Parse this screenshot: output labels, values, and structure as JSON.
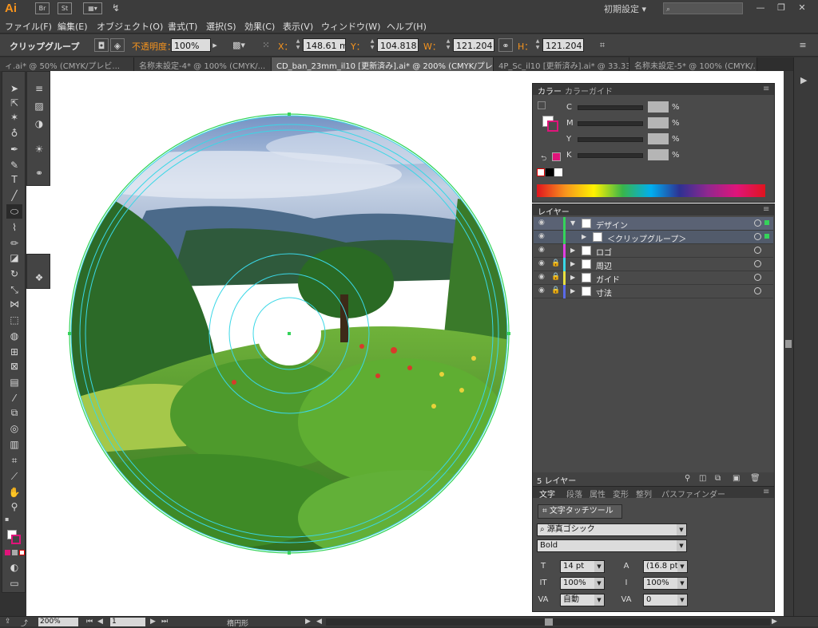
{
  "app": {
    "logo": "Ai",
    "icon_bridge": "Br",
    "icon_stock": "St",
    "workspace_preset": "初期設定",
    "window_minimize": "—",
    "window_restore": "❐",
    "window_close": "✕"
  },
  "menu": [
    "ファイル(F)",
    "編集(E)",
    "オブジェクト(O)",
    "書式(T)",
    "選択(S)",
    "効果(C)",
    "表示(V)",
    "ウィンドウ(W)",
    "ヘルプ(H)"
  ],
  "control": {
    "selection_type": "クリップグループ",
    "opacity_label": "不透明度：",
    "opacity_value": "100%",
    "x_label": "X：",
    "x_value": "148.61 mr",
    "y_label": "Y：",
    "y_value": "104.818 m",
    "w_label": "W：",
    "w_value": "121.204 m",
    "h_label": "H：",
    "h_value": "121.204 m"
  },
  "tabs": [
    {
      "label": "ィ.ai* @ 50% (CMYK/プレビ...",
      "active": false
    },
    {
      "label": "名称未設定-4* @ 100% (CMYK/...",
      "active": false
    },
    {
      "label": "CD_ban_23mm_il10 [更新済み].ai* @ 200% (CMYK/プレビュー)",
      "active": true
    },
    {
      "label": "4P_Sc_il10 [更新済み].ai* @ 33.33...",
      "active": false
    },
    {
      "label": "名称未設定-5* @ 100% (CMYK/...",
      "active": false
    }
  ],
  "color_panel": {
    "tab_color": "カラー",
    "tab_guide": "カラーガイド",
    "channels": [
      {
        "label": "C",
        "pct": "%"
      },
      {
        "label": "M",
        "pct": "%"
      },
      {
        "label": "Y",
        "pct": "%"
      },
      {
        "label": "K",
        "pct": "%"
      }
    ],
    "k_swatch": "#e0147a"
  },
  "layers_panel": {
    "tab": "レイヤー",
    "rows": [
      {
        "name": "デザイン",
        "color": "#35d35a",
        "indent": 0,
        "expanded": true,
        "locked": false,
        "selected": true
      },
      {
        "name": "＜クリップグループ＞",
        "color": "#35d35a",
        "indent": 1,
        "expanded": false,
        "locked": false,
        "selected": true
      },
      {
        "name": "ロゴ",
        "color": "#e040e0",
        "indent": 0,
        "expanded": false,
        "locked": false,
        "selected": false
      },
      {
        "name": "周辺",
        "color": "#3ad7e6",
        "indent": 0,
        "expanded": false,
        "locked": true,
        "selected": false
      },
      {
        "name": "ガイド",
        "color": "#e8e040",
        "indent": 0,
        "expanded": false,
        "locked": true,
        "selected": false
      },
      {
        "name": "寸法",
        "color": "#5a6ae8",
        "indent": 0,
        "expanded": false,
        "locked": true,
        "selected": false
      }
    ],
    "count_label": "5 レイヤー"
  },
  "type_panel": {
    "tabs": [
      "文字",
      "段落",
      "属性",
      "変形",
      "整列",
      "パスファインダー"
    ],
    "touch_tool": "文字タッチツール",
    "font_family": "源真ゴシック",
    "font_style": "Bold",
    "size": "14 pt",
    "leading": "(16.8 pt",
    "vscale": "100%",
    "hscale": "100%",
    "kerning": "自動",
    "tracking": "0"
  },
  "status": {
    "zoom": "200%",
    "artboard": "1",
    "tool_name": "楕円形"
  }
}
